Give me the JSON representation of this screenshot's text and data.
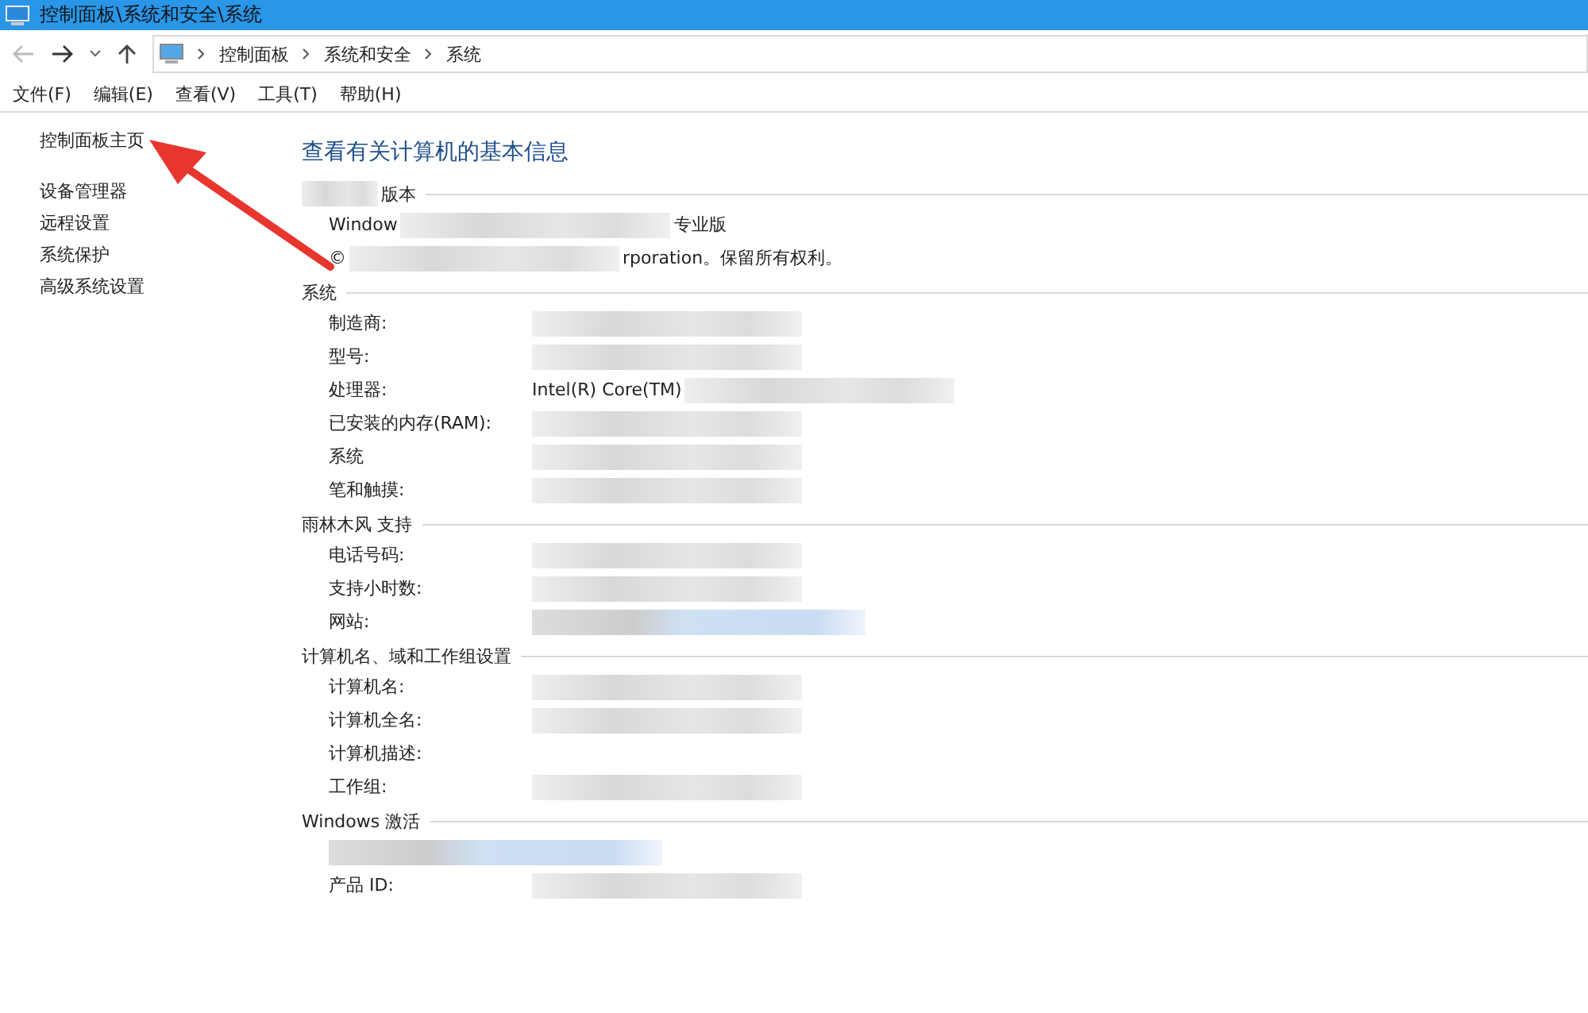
{
  "window": {
    "title": "控制面板\\系统和安全\\系统"
  },
  "address_bar": {
    "back_disabled": true,
    "forward_disabled": false,
    "breadcrumb": [
      "控制面板",
      "系统和安全",
      "系统"
    ]
  },
  "menu": [
    "文件(F)",
    "编辑(E)",
    "查看(V)",
    "工具(T)",
    "帮助(H)"
  ],
  "sidebar": {
    "items": [
      "控制面板主页",
      "设备管理器",
      "远程设置",
      "系统保护",
      "高级系统设置"
    ]
  },
  "page_title": "查看有关计算机的基本信息",
  "sections": [
    {
      "heading": [
        {
          "kind": "redacted"
        },
        {
          "kind": "text",
          "text": "版本"
        }
      ],
      "rows": [
        {
          "value": [
            {
              "kind": "text",
              "text": "Window"
            },
            {
              "kind": "redacted"
            },
            {
              "kind": "text",
              "text": "专业版"
            }
          ]
        },
        {
          "value": [
            {
              "kind": "text",
              "text": "©"
            },
            {
              "kind": "redacted"
            },
            {
              "kind": "text",
              "text": "rporation。保留所有权利。"
            }
          ]
        }
      ]
    },
    {
      "heading": [
        {
          "kind": "text",
          "text": "系统"
        }
      ],
      "rows": [
        {
          "label": "制造商:",
          "value": [
            {
              "kind": "redacted"
            }
          ]
        },
        {
          "label": "型号:",
          "value": [
            {
              "kind": "redacted"
            }
          ]
        },
        {
          "label": "处理器:",
          "value": [
            {
              "kind": "text",
              "text": "Intel(R) Core(TM)"
            },
            {
              "kind": "redacted"
            }
          ]
        },
        {
          "label": "已安装的内存(RAM):",
          "value": [
            {
              "kind": "redacted"
            }
          ]
        },
        {
          "label": "系统",
          "value": [
            {
              "kind": "redacted"
            }
          ]
        },
        {
          "label": "笔和触摸:",
          "value": [
            {
              "kind": "redacted"
            }
          ]
        }
      ]
    },
    {
      "heading": [
        {
          "kind": "text",
          "text": "雨林木风 支持"
        }
      ],
      "rows": [
        {
          "label": "电话号码:",
          "value": [
            {
              "kind": "redacted"
            }
          ]
        },
        {
          "label": "支持小时数:",
          "value": [
            {
              "kind": "redacted"
            }
          ]
        },
        {
          "label": "网站:",
          "value": [
            {
              "kind": "redacted-link"
            }
          ]
        }
      ]
    },
    {
      "heading": [
        {
          "kind": "text",
          "text": "计算机名、域和工作组设置"
        }
      ],
      "rows": [
        {
          "label": "计算机名:",
          "value": [
            {
              "kind": "redacted"
            }
          ]
        },
        {
          "label": "计算机全名:",
          "value": [
            {
              "kind": "redacted"
            }
          ]
        },
        {
          "label": "计算机描述:"
        },
        {
          "label": "工作组:",
          "value": [
            {
              "kind": "redacted"
            }
          ]
        }
      ]
    },
    {
      "heading": [
        {
          "kind": "text",
          "text": "Windows 激活"
        }
      ],
      "rows": [
        {
          "value": [
            {
              "kind": "redacted-link"
            }
          ]
        },
        {
          "label": "产品 ID:",
          "value": [
            {
              "kind": "redacted"
            }
          ]
        }
      ]
    }
  ]
}
